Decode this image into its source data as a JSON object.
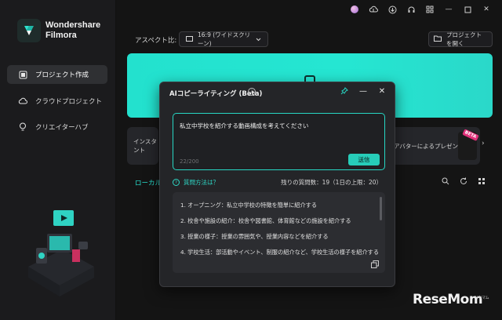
{
  "app": {
    "brand_line1": "Wondershare",
    "brand_line2": "Filmora"
  },
  "sidebar": {
    "items": [
      {
        "label": "プロジェクト作成",
        "icon": "new-project-icon",
        "active": true
      },
      {
        "label": "クラウドプロジェクト",
        "icon": "cloud-icon",
        "active": false
      },
      {
        "label": "クリエイターハブ",
        "icon": "lightbulb-icon",
        "active": false
      }
    ]
  },
  "toolbar": {
    "aspect_label": "アスペクト比:",
    "aspect_value": "16:9 (ワイドスクリーン)",
    "open_project": "プロジェクトを開く"
  },
  "cards": {
    "left_label": "インスタント",
    "right_label": "アバターによるプレゼン",
    "beta_badge": "BETA"
  },
  "local_tab": "ローカルプ",
  "dialog": {
    "title": "AIコピーライティング (Beta)",
    "prompt": "私立中学校を紹介する動画構成を考えてください",
    "char_count": "22/200",
    "send_label": "送信",
    "help_link": "質問方法は？",
    "remaining": "残りの質問数：19（1日の上限：20）",
    "results": [
      "1. オープニング：私立中学校の特徴を簡単に紹介する",
      "2. 校舎や施設の紹介：校舎や図書館、体育館などの施設を紹介する",
      "3. 授業の様子：授業の雰囲気や、授業内容などを紹介する",
      "4. 学校生活：部活動やイベント、制服の紹介など、学校生活の様子を紹介する"
    ]
  },
  "watermark": {
    "text": "ReseMom",
    "sub": "リセマム"
  },
  "colors": {
    "accent": "#27cdb9",
    "banner": "#25e6d2",
    "background": "#141414"
  }
}
